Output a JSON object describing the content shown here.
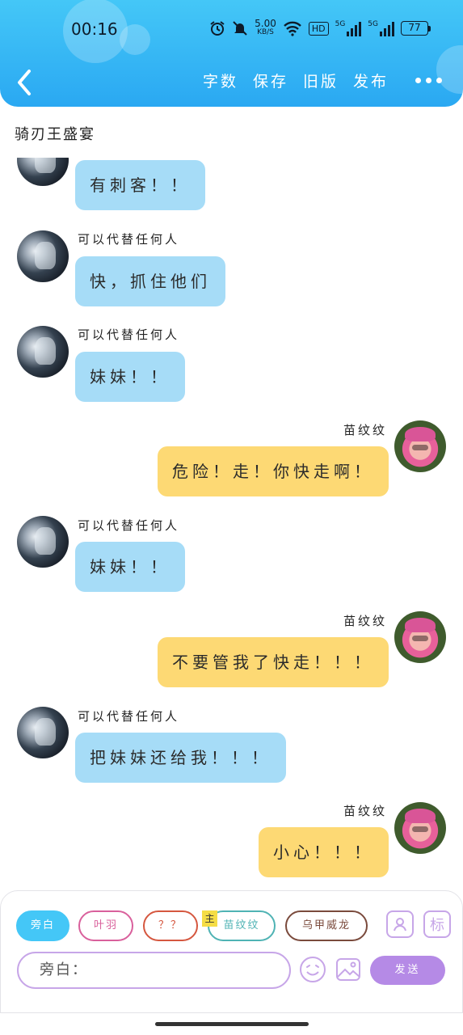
{
  "status_bar": {
    "time": "00:16",
    "speed_value": "5.00",
    "speed_unit": "KB/S",
    "hd_label": "HD",
    "signal_1_label": "5G",
    "signal_2_label": "5G",
    "battery_level": "77"
  },
  "header": {
    "actions": [
      "字数",
      "保存",
      "旧版",
      "发布"
    ],
    "accent_color": "#2aa8f2"
  },
  "room_title": "骑刃王盛宴",
  "messages": [
    {
      "side": "left",
      "sender": "",
      "text": "有刺客！！"
    },
    {
      "side": "left",
      "sender": "可以代替任何人",
      "text": "快，抓住他们"
    },
    {
      "side": "left",
      "sender": "可以代替任何人",
      "text": "妹妹！！"
    },
    {
      "side": "right",
      "sender": "苗纹纹",
      "text": "危险！走！你快走啊！"
    },
    {
      "side": "left",
      "sender": "可以代替任何人",
      "text": "妹妹！！"
    },
    {
      "side": "right",
      "sender": "苗纹纹",
      "text": "不要管我了快走！！！"
    },
    {
      "side": "left",
      "sender": "可以代替任何人",
      "text": "把妹妹还给我！！！"
    },
    {
      "side": "right",
      "sender": "苗纹纹",
      "text": "小心！！！"
    }
  ],
  "composer": {
    "roles": [
      "旁白",
      "叶羽",
      "？？",
      "苗纹纹",
      "乌甲威龙"
    ],
    "main_tag": "主",
    "mark_button": "标",
    "input_value": "旁白：",
    "send_label": "发送"
  }
}
